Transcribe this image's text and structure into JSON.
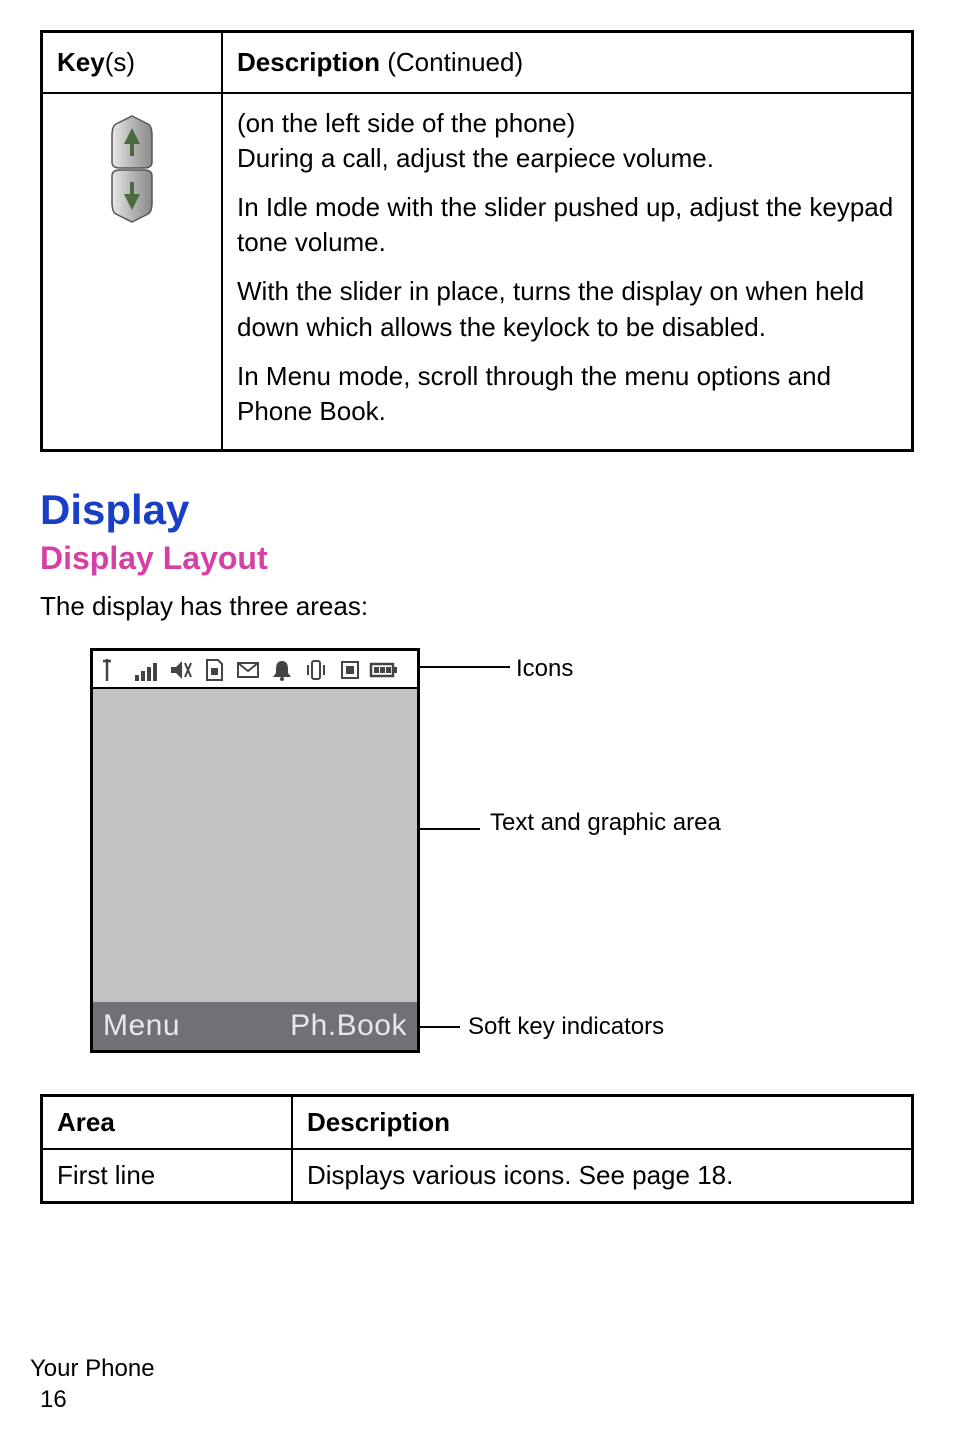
{
  "key_table": {
    "header_key_strong": "Key",
    "header_key_plain": "(s)",
    "header_desc_strong": "Description ",
    "header_desc_plain": "(Continued)",
    "row": {
      "p1_line1": "(on the left side of the phone)",
      "p1_line2": "During a call, adjust the earpiece volume.",
      "p2": "In Idle mode with the slider pushed up, adjust the keypad tone volume.",
      "p3": "With the slider in place, turns the display on when held down which allows the keylock to be disabled.",
      "p4": "In Menu mode, scroll through the menu options and Phone Book."
    }
  },
  "headings": {
    "display": "Display",
    "layout": "Display Layout"
  },
  "lead": "The display has three areas:",
  "diagram": {
    "soft_left": "Menu",
    "soft_right": "Ph.Book",
    "callout_icons": "Icons",
    "callout_text": "Text and graphic area",
    "callout_soft": "Soft key indicators"
  },
  "area_table": {
    "h_area": "Area",
    "h_desc": "Description",
    "r1_area": "First line",
    "r1_desc": "Displays various icons. See page 18."
  },
  "footer": {
    "section": "Your Phone",
    "page": "16"
  }
}
